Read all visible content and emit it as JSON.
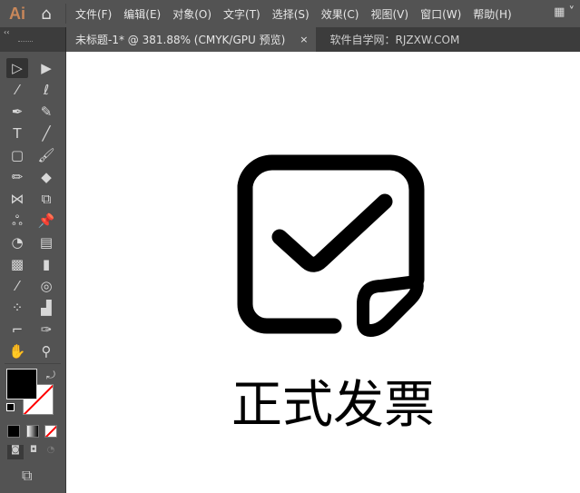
{
  "app": {
    "logo": "Ai"
  },
  "menu": [
    "文件(F)",
    "编辑(E)",
    "对象(O)",
    "文字(T)",
    "选择(S)",
    "效果(C)",
    "视图(V)",
    "窗口(W)",
    "帮助(H)"
  ],
  "tabs": {
    "active": "未标题-1* @ 381.88% (CMYK/GPU 预览)",
    "close": "×",
    "watermark": "软件自学网：RJZXW.COM"
  },
  "toolbar": {
    "collapse": "‹‹"
  },
  "artwork": {
    "title": "正式发票",
    "icon": "invoice-check-icon"
  },
  "colors": {
    "fill": "#000000",
    "stroke": "none",
    "accent": "#ff0000"
  }
}
